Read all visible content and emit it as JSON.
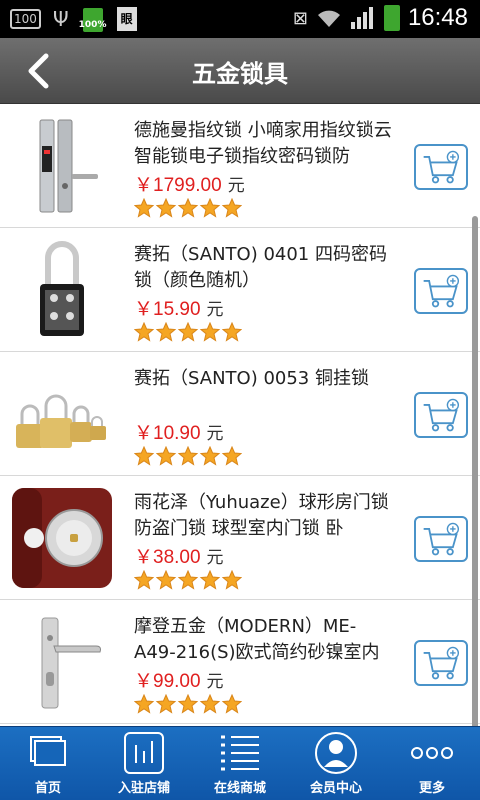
{
  "status": {
    "badge": "100",
    "battery_small": "100%",
    "doc_icon": "眼",
    "time": "16:48"
  },
  "header": {
    "title": "五金锁具"
  },
  "products": [
    {
      "name": "德施曼指纹锁 小嘀家用指纹锁云智能锁电子锁指纹密码锁防",
      "price": "￥1799.00",
      "unit": "元",
      "rating": 5
    },
    {
      "name": "赛拓（SANTO) 0401 四码密码锁（颜色随机）",
      "price": "￥15.90",
      "unit": "元",
      "rating": 5
    },
    {
      "name": "赛拓（SANTO) 0053 铜挂锁",
      "price": "￥10.90",
      "unit": "元",
      "rating": 5
    },
    {
      "name": "雨花泽（Yuhuaze）球形房门锁 防盗门锁 球型室内门锁 卧",
      "price": "￥38.00",
      "unit": "元",
      "rating": 5
    },
    {
      "name": "摩登五金（MODERN）ME-A49-216(S)欧式简约砂镍室内",
      "price": "￥99.00",
      "unit": "元",
      "rating": 5
    }
  ],
  "tabs": [
    {
      "label": "首页",
      "icon": "home-icon"
    },
    {
      "label": "入驻店铺",
      "icon": "store-icon"
    },
    {
      "label": "在线商城",
      "icon": "list-icon"
    },
    {
      "label": "会员中心",
      "icon": "member-icon"
    },
    {
      "label": "更多",
      "icon": "more-icon"
    }
  ],
  "colors": {
    "price": "#e02020",
    "accent": "#4a93c9",
    "tabbar": "#1565b8",
    "star": "#f5a623"
  }
}
